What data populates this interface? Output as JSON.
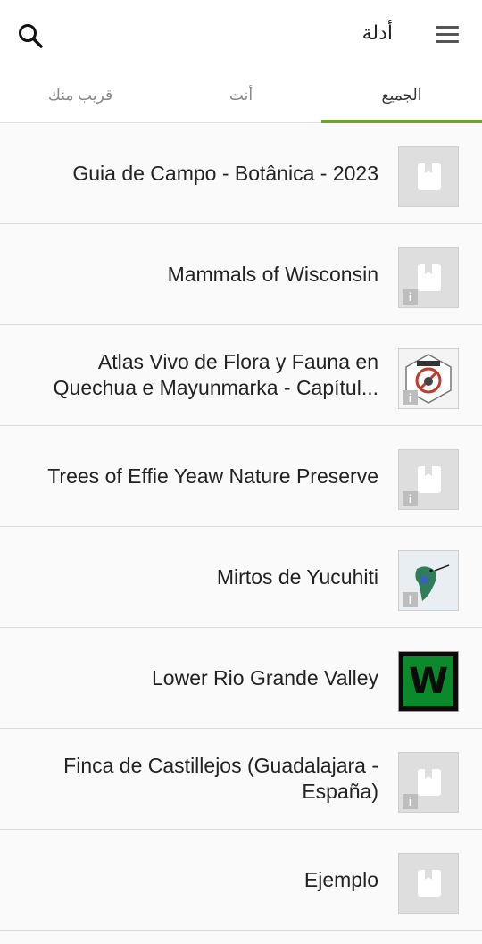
{
  "appbar": {
    "title": "أدلة",
    "search_icon": "search-icon",
    "menu_icon": "hamburger-menu-icon"
  },
  "tabs": [
    {
      "label": "قريب منك"
    },
    {
      "label": "أنت"
    },
    {
      "label": "الجميع",
      "selected": true
    }
  ],
  "accent_color": "#6aa42c",
  "guides": [
    {
      "title_lines": [
        "Guia de Campo - Botânica - 2023"
      ],
      "thumb": "book-placeholder",
      "info": false
    },
    {
      "title_lines": [
        "Mammals of Wisconsin"
      ],
      "thumb": "book-placeholder",
      "info": true
    },
    {
      "title_lines": [
        "Atlas Vivo de Flora y Fauna en",
        "Quechua e Mayunmarka - Capítul..."
      ],
      "thumb": "atlas-logo",
      "info": true
    },
    {
      "title_lines": [
        "Trees of Effie Yeaw Nature Preserve"
      ],
      "thumb": "book-placeholder",
      "info": true
    },
    {
      "title_lines": [
        "Mirtos de Yucuhiti"
      ],
      "thumb": "hummingbird-photo",
      "info": true
    },
    {
      "title_lines": [
        "Lower Rio Grande Valley"
      ],
      "thumb": "w-logo",
      "thumb_text": "W",
      "info": false
    },
    {
      "title_lines": [
        "Finca de Castillejos (Guadalajara -",
        "España)"
      ],
      "thumb": "book-placeholder",
      "info": true
    },
    {
      "title_lines": [
        "Ejemplo"
      ],
      "thumb": "book-placeholder",
      "info": false
    }
  ]
}
